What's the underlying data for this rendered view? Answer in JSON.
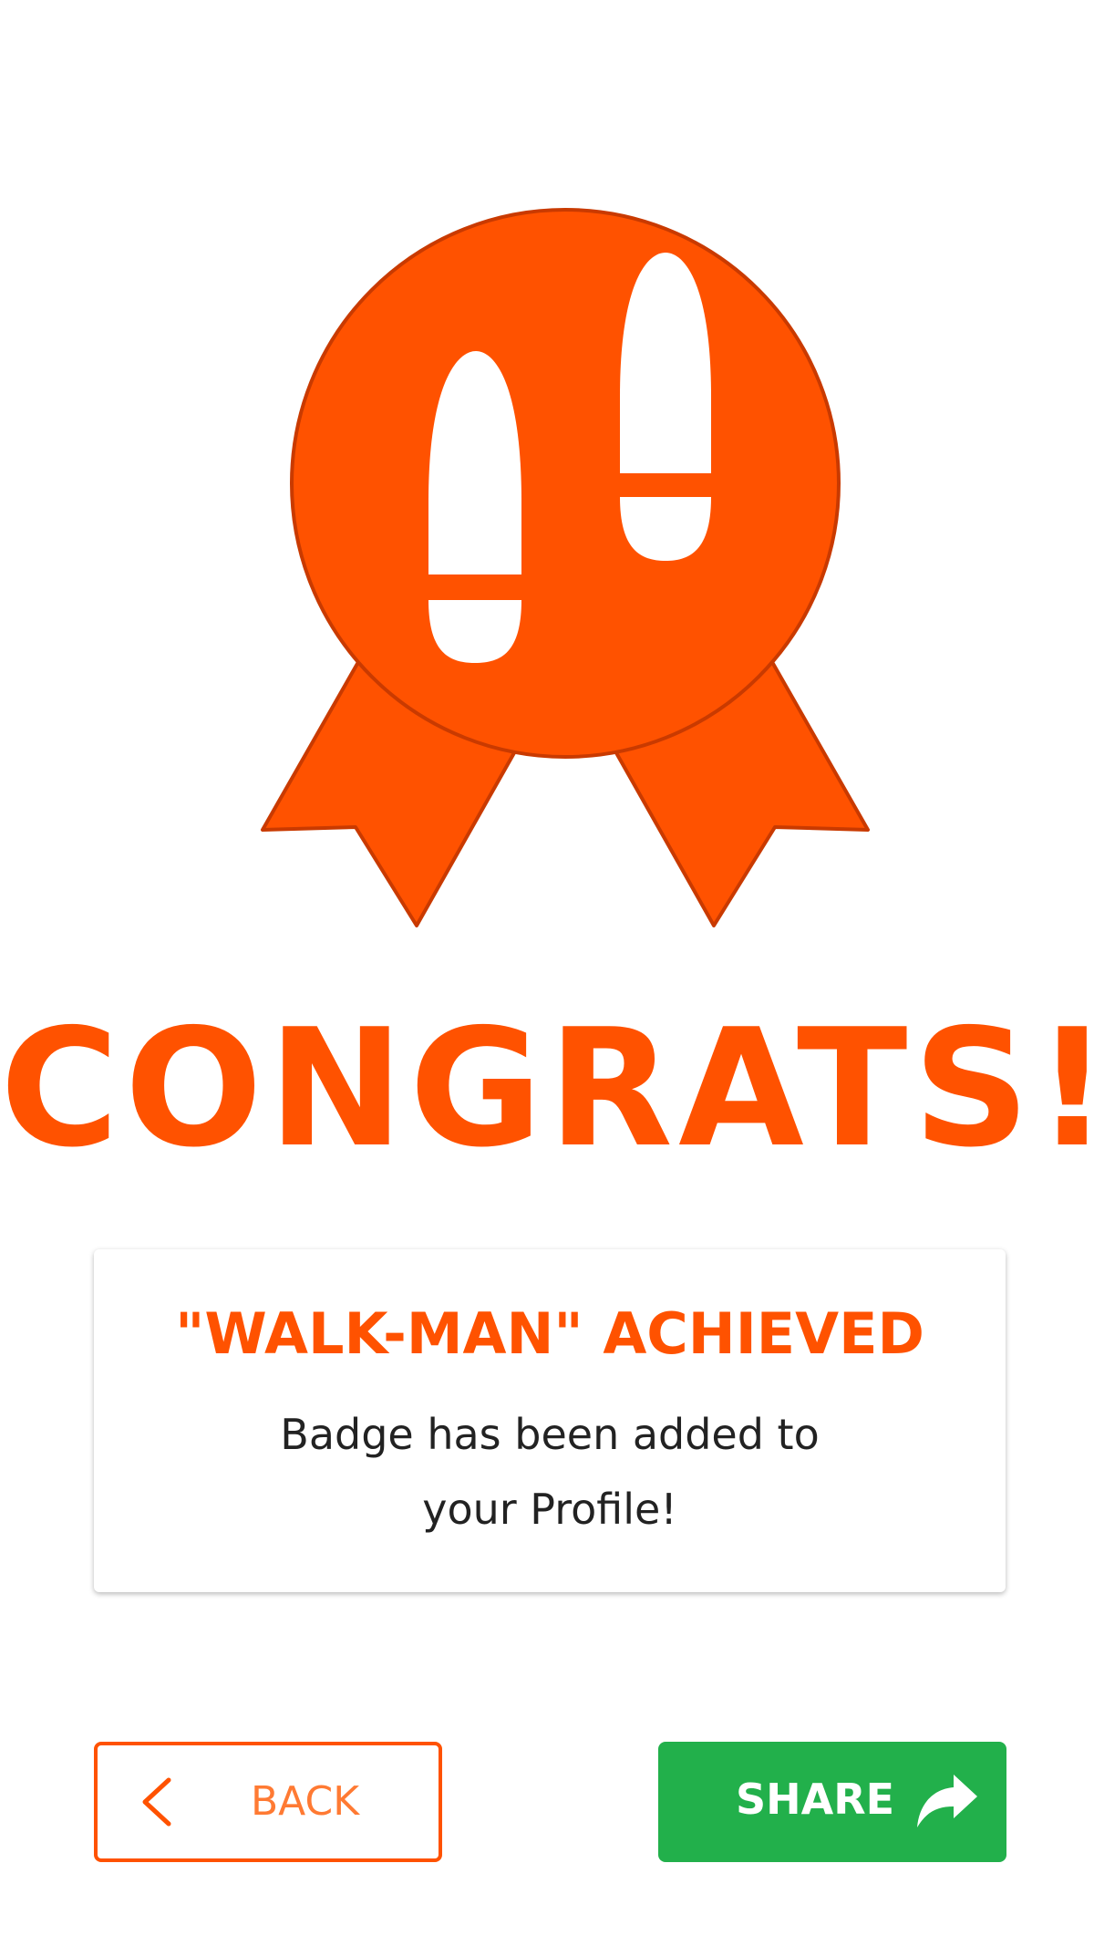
{
  "title": "CONGRATS!",
  "card": {
    "heading": "\"WALK-MAN\" ACHIEVED",
    "line1": "Badge has been added to",
    "line2": "your Profile!"
  },
  "buttons": {
    "back_label": "BACK",
    "share_label": "SHARE"
  },
  "icons": {
    "badge": "footprints-medal-icon",
    "back": "chevron-left-icon",
    "share": "share-arrow-icon"
  },
  "colors": {
    "accent": "#ff5200",
    "accent_dark": "#c93a00",
    "share": "#22b04b",
    "background": "#ffffff"
  }
}
